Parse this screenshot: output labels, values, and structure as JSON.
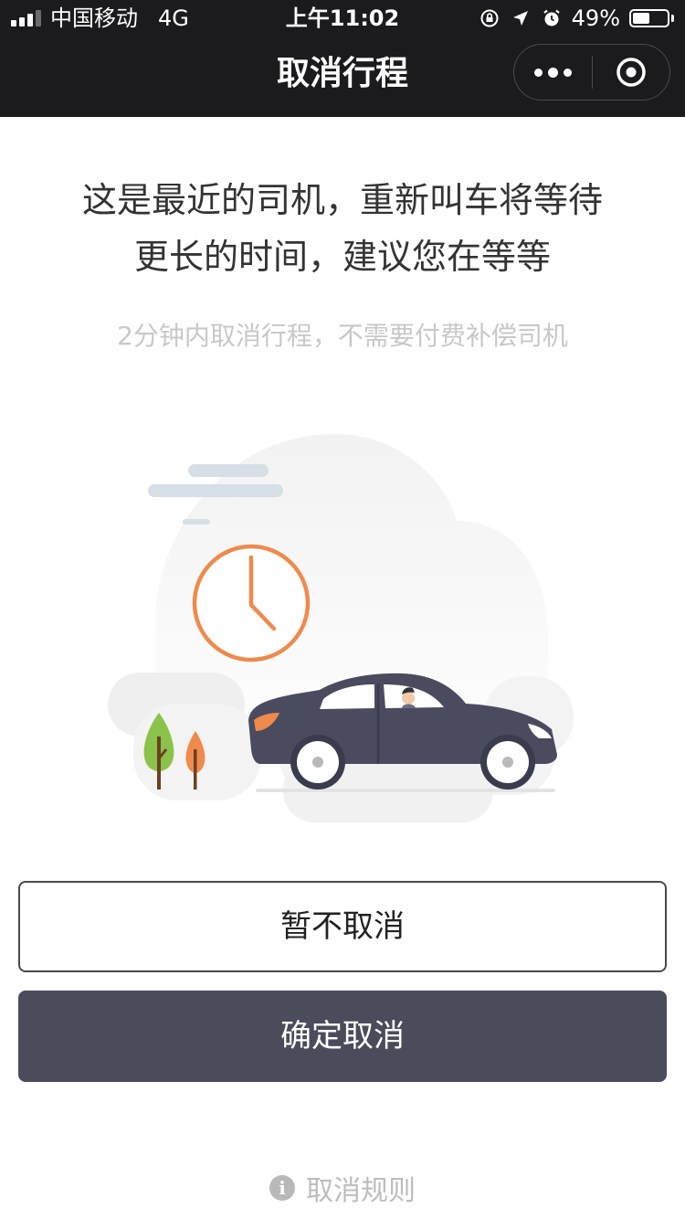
{
  "status_bar": {
    "carrier": "中国移动",
    "network": "4G",
    "time": "上午11:02",
    "battery_percent": "49%",
    "battery_level": 0.49,
    "icons": [
      "orientation-lock-icon",
      "location-arrow-icon",
      "alarm-icon",
      "battery-icon"
    ]
  },
  "nav": {
    "title": "取消行程",
    "more_icon": "more-dots-icon",
    "close_icon": "target-close-icon"
  },
  "main": {
    "headline_line1": "这是最近的司机，重新叫车将等待",
    "headline_line2": "更长的时间，建议您在等等",
    "subline": "2分钟内取消行程，不需要付费补偿司机",
    "illustration": "clock-car-illustration"
  },
  "buttons": {
    "keep_label": "暂不取消",
    "confirm_label": "确定取消"
  },
  "footer": {
    "rules_label": "取消规则",
    "rules_icon": "info-icon"
  },
  "colors": {
    "top_bar": "#1b1b1d",
    "confirm_button": "#4a4b5b",
    "clock_orange": "#ef8a4c",
    "car_body": "#4a4b5f",
    "tree_green": "#8bc34a",
    "tree_orange": "#ef8a4c"
  }
}
